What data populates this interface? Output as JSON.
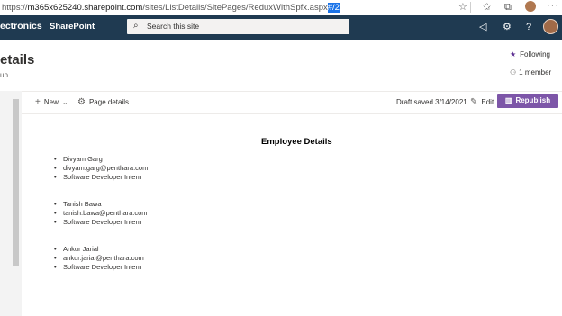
{
  "browser": {
    "url_scheme": "https://",
    "url_domain": "m365x625240.sharepoint.com",
    "url_path": "/sites/ListDetails/SitePages/ReduxWithSpfx.aspx",
    "url_hash_selected": "#/2",
    "icons": [
      "favorite-star-icon",
      "collections-icon",
      "favorites-icon",
      "browser-profile-icon",
      "more-icon"
    ]
  },
  "suitebar": {
    "brand": "ectronics",
    "app_name": "SharePoint",
    "search_placeholder": "Search this site",
    "icons": [
      "megaphone-icon",
      "settings-icon",
      "help-icon",
      "user-avatar"
    ]
  },
  "site": {
    "title": "etails",
    "subtitle": "up",
    "following_label": "Following",
    "members_label": "1 member"
  },
  "commandbar": {
    "new_label": "New",
    "page_details_label": "Page details",
    "draft_status": "Draft saved 3/14/2021",
    "edit_label": "Edit",
    "republish_label": "Republish"
  },
  "content": {
    "heading": "Employee Details",
    "employees": [
      {
        "name": "Divyam Garg",
        "email": "divyam.garg@penthara.com",
        "role": "Software Developer Intern"
      },
      {
        "name": "Tanish Bawa",
        "email": "tanish.bawa@penthara.com",
        "role": "Software Developer Intern"
      },
      {
        "name": "Ankur Jarial",
        "email": "ankur.jarial@penthara.com",
        "role": "Software Developer Intern"
      }
    ]
  },
  "colors": {
    "suitebar_bg": "#1f3a51",
    "accent_purple": "#7d56a8",
    "url_selection": "#1a73e8"
  }
}
